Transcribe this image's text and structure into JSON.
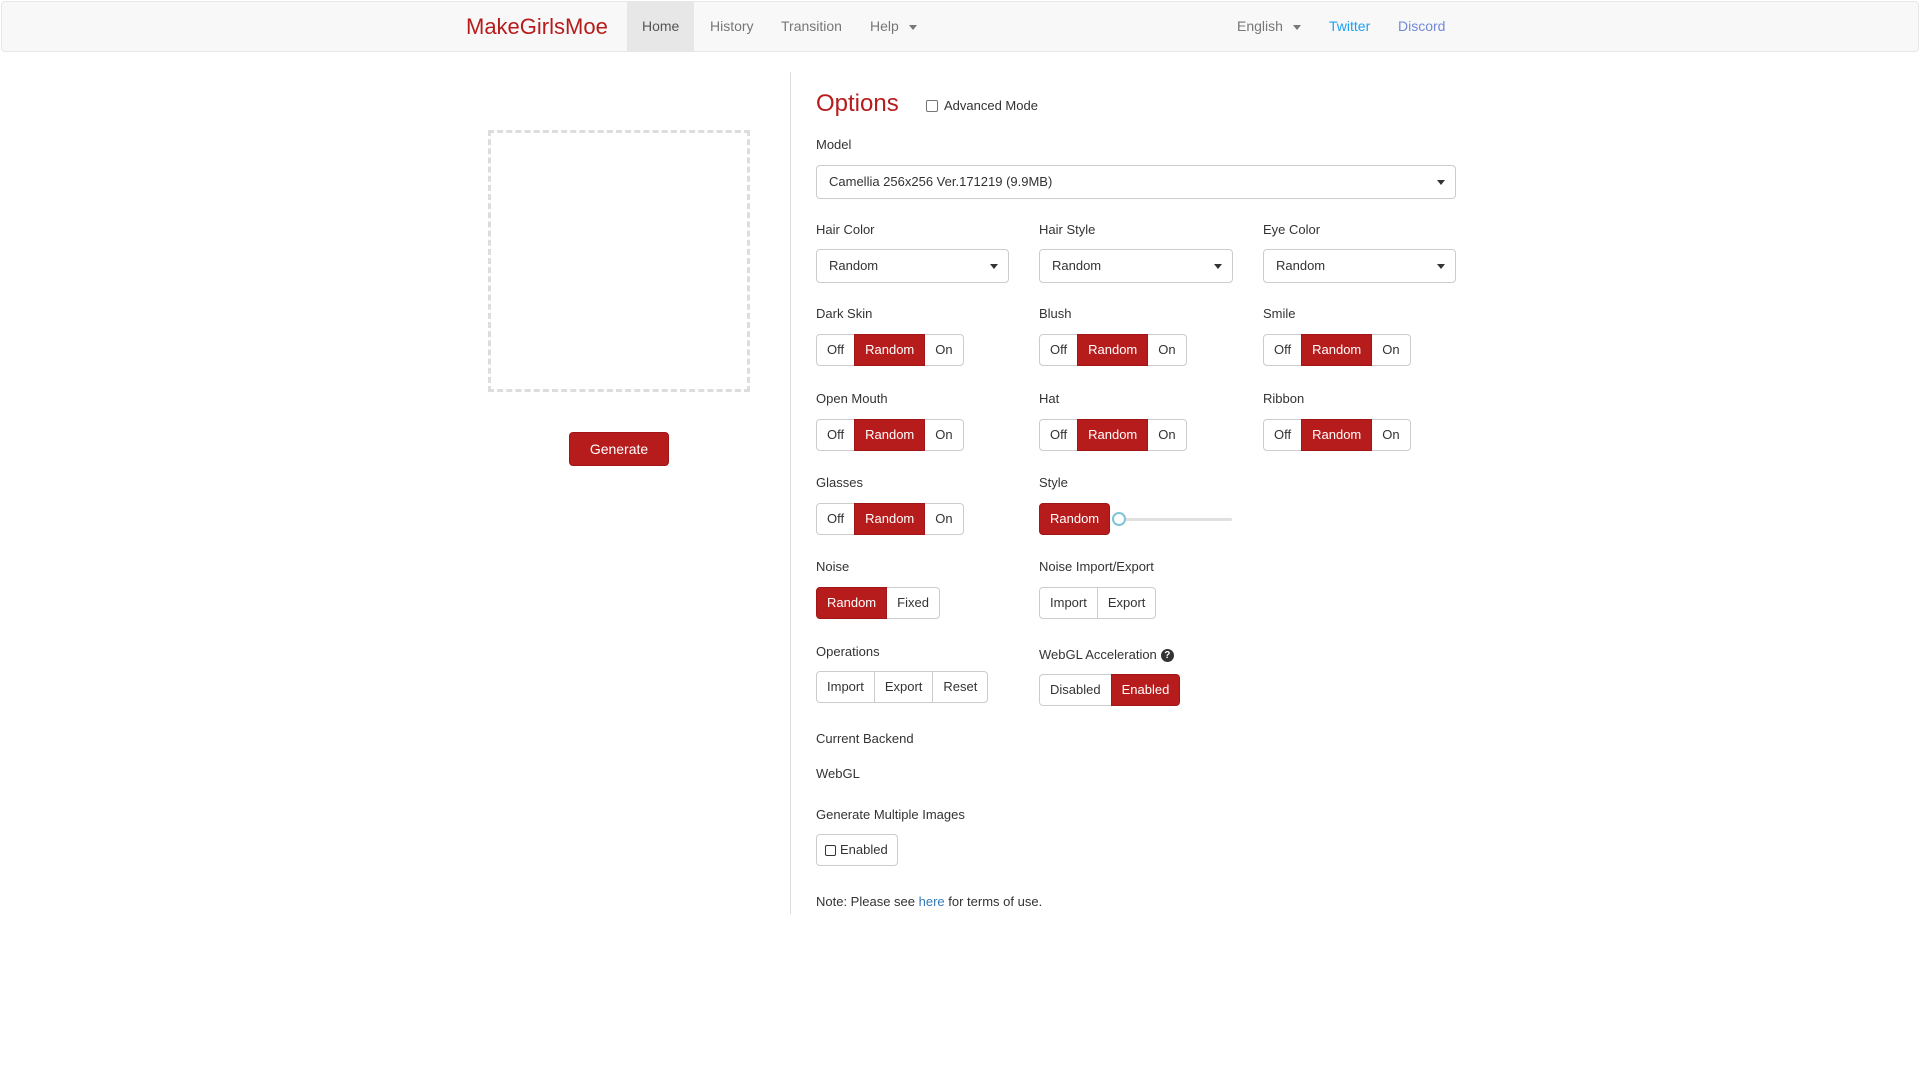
{
  "nav": {
    "brand": "MakeGirlsMoe",
    "home": "Home",
    "history": "History",
    "transition": "Transition",
    "help": "Help",
    "language": "English",
    "twitter": "Twitter",
    "discord": "Discord"
  },
  "left": {
    "generate_label": "Generate"
  },
  "options": {
    "title": "Options",
    "advanced_mode": "Advanced Mode",
    "model_label": "Model",
    "model_value": "Camellia 256x256 Ver.171219 (9.9MB)",
    "hair_color_label": "Hair Color",
    "hair_color_value": "Random",
    "hair_style_label": "Hair Style",
    "hair_style_value": "Random",
    "eye_color_label": "Eye Color",
    "eye_color_value": "Random",
    "dark_skin_label": "Dark Skin",
    "blush_label": "Blush",
    "smile_label": "Smile",
    "open_mouth_label": "Open Mouth",
    "hat_label": "Hat",
    "ribbon_label": "Ribbon",
    "glasses_label": "Glasses",
    "style_label": "Style",
    "tri": {
      "off": "Off",
      "random": "Random",
      "on": "On"
    },
    "style_random": "Random",
    "noise_label": "Noise",
    "noise_random": "Random",
    "noise_fixed": "Fixed",
    "noise_ie_label": "Noise Import/Export",
    "import": "Import",
    "export": "Export",
    "reset": "Reset",
    "operations_label": "Operations",
    "webgl_label": "WebGL Acceleration",
    "webgl_disabled": "Disabled",
    "webgl_enabled": "Enabled",
    "backend_label": "Current Backend",
    "backend_value": "WebGL",
    "multi_label": "Generate Multiple Images",
    "multi_enabled": "Enabled",
    "note_prefix": "Note: Please see ",
    "note_link": "here",
    "note_suffix": " for terms of use."
  },
  "colors": {
    "accent": "#b71c1c",
    "link": "#337ab7",
    "twitter": "#1da1f2",
    "discord": "#7289da"
  },
  "icons": [
    "caret-down-icon",
    "question-circle-icon",
    "checkbox-icon"
  ]
}
